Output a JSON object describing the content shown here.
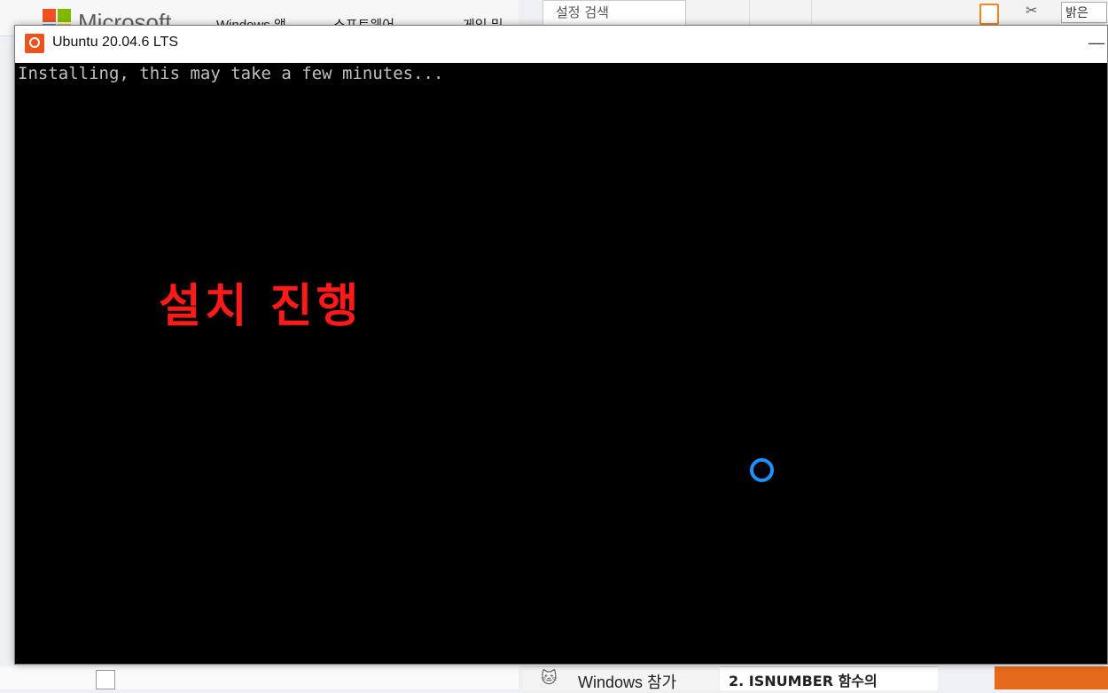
{
  "background": {
    "store": {
      "brand": "Microsoft",
      "nav": [
        "Windows 앱",
        "소프트웨어",
        "게임 및"
      ]
    },
    "settings_search": "설정 검색",
    "ribbon_box": "밝은",
    "bottom_nav_label": "Windows 참가",
    "bottom_doc_label": "2. ISNUMBER 함수의"
  },
  "window": {
    "title": "Ubuntu 20.04.6 LTS",
    "minimize_label": "—",
    "console_text": "Installing, this may take a few minutes...",
    "annotation": "설치 진행"
  },
  "colors": {
    "accent_ubuntu": "#e95420",
    "annotation": "#ff1a1a",
    "spinner": "#1e90ff"
  }
}
